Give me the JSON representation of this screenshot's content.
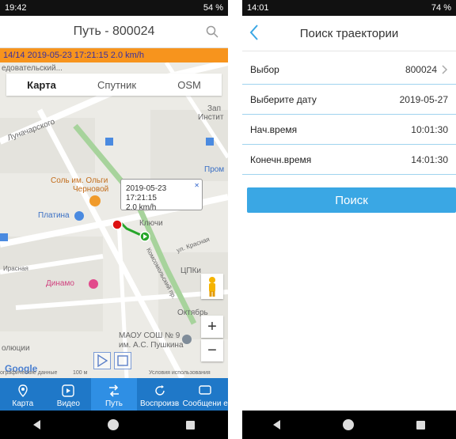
{
  "left": {
    "status": {
      "time": "19:42",
      "battery": "54 %"
    },
    "title": "Путь - 800024",
    "info": "14/14  2019-05-23 17:21:15  2.0 km/h",
    "map_tabs": [
      "Карта",
      "Спутник",
      "OSM"
    ],
    "popup": {
      "line1": "2019-05-23 17:21:15",
      "line2": "2.0 km/h"
    },
    "map_labels": {
      "l1": "едовательский...",
      "l2": "Луначарского",
      "l3": "Соль им. Ольги",
      "l4": "Черновой",
      "l5": "Платина",
      "l6": "Ключи",
      "l7": "Динамо",
      "l8": "МАОУ СОШ № 9",
      "l9": "им. А.С. Пушкина",
      "l10": "Октябрь",
      "l11": "Зап",
      "l12": "Инстит",
      "l13": "Пром",
      "l14": "ЦПКи",
      "l15": "ул. Красная",
      "l16": "Комсомольский пр.",
      "l17": "Google",
      "l18": "Условия использования",
      "l19": "100 м",
      "l20": "ографические данные",
      "l21": "Ирасная",
      "l22": "олюции"
    },
    "zoom_in": "+",
    "zoom_out": "−",
    "tabs": [
      "Карта",
      "Видео",
      "Путь",
      "Воспроизв",
      "Сообщени е"
    ]
  },
  "right": {
    "status": {
      "time": "14:01",
      "battery": "74 %"
    },
    "title": "Поиск траектории",
    "rows": [
      {
        "label": "Выбор",
        "value": "800024"
      },
      {
        "label": "Выберите дату",
        "value": "2019-05-27"
      },
      {
        "label": "Нач.время",
        "value": "10:01:30"
      },
      {
        "label": "Конечн.время",
        "value": "14:01:30"
      }
    ],
    "search_button": "Поиск"
  }
}
